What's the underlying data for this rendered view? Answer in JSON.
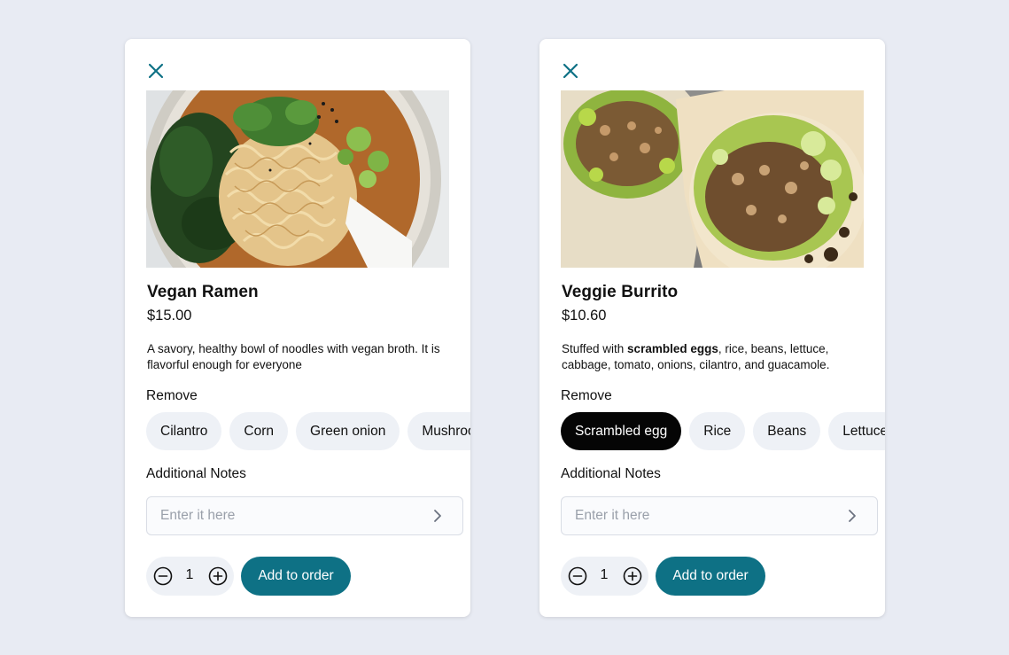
{
  "colors": {
    "accent": "#0e7185",
    "chip_bg": "#eef1f6",
    "chip_selected_bg": "#050505",
    "page_bg": "#e8ebf3"
  },
  "icons": {
    "close": "close-icon",
    "chevron": "chevron-right-icon",
    "minus": "minus-circle-icon",
    "plus": "plus-circle-icon"
  },
  "cards": [
    {
      "title": "Vegan Ramen",
      "price": "$15.00",
      "description": "A savory, healthy bowl of noodles with vegan broth. It is flavorful enough for everyone",
      "remove_label": "Remove",
      "chips": [
        {
          "label": "Cilantro",
          "selected": false
        },
        {
          "label": "Corn",
          "selected": false
        },
        {
          "label": "Green onion",
          "selected": false
        },
        {
          "label": "Mushrooms",
          "selected": false
        }
      ],
      "notes_label": "Additional Notes",
      "notes_placeholder": "Enter it here",
      "quantity": "1",
      "add_label": "Add to order"
    },
    {
      "title": "Veggie Burrito",
      "price": "$10.60",
      "description_prefix": "Stuffed with ",
      "description_bold": "scrambled eggs",
      "description_suffix": ", rice, beans, lettuce, cabbage, tomato, onions, cilantro, and guacamole.",
      "remove_label": "Remove",
      "chips": [
        {
          "label": "Scrambled egg",
          "selected": true
        },
        {
          "label": "Rice",
          "selected": false
        },
        {
          "label": "Beans",
          "selected": false
        },
        {
          "label": "Lettuce",
          "selected": false
        }
      ],
      "notes_label": "Additional Notes",
      "notes_placeholder": "Enter it here",
      "quantity": "1",
      "add_label": "Add to order"
    }
  ]
}
